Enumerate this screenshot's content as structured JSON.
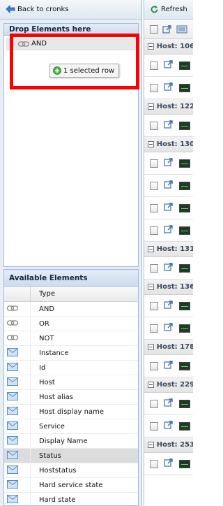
{
  "left_toolbar": {
    "back_label": "Back to cronks"
  },
  "drop_panel": {
    "title": "Drop Elements here",
    "tree_node_label": "AND",
    "drag_tooltip": "1 selected row"
  },
  "available_panel": {
    "title": "Available Elements",
    "column_type": "Type",
    "items": [
      {
        "label": "AND",
        "icon": "link-icon"
      },
      {
        "label": "OR",
        "icon": "link-icon"
      },
      {
        "label": "NOT",
        "icon": "link-icon"
      },
      {
        "label": "Instance",
        "icon": "envelope-icon"
      },
      {
        "label": "Id",
        "icon": "envelope-icon"
      },
      {
        "label": "Host",
        "icon": "envelope-icon"
      },
      {
        "label": "Host alias",
        "icon": "envelope-icon"
      },
      {
        "label": "Host display name",
        "icon": "envelope-icon"
      },
      {
        "label": "Service",
        "icon": "envelope-icon"
      },
      {
        "label": "Display Name",
        "icon": "envelope-icon"
      },
      {
        "label": "Status",
        "icon": "envelope-icon",
        "selected": true
      },
      {
        "label": "Hoststatus",
        "icon": "envelope-icon"
      },
      {
        "label": "Hard service state",
        "icon": "envelope-icon"
      },
      {
        "label": "Hard state",
        "icon": "envelope-icon"
      }
    ]
  },
  "right_toolbar": {
    "refresh_label": "Refresh"
  },
  "host_groups": [
    {
      "label": "Host: 106",
      "rows": 2
    },
    {
      "label": "Host: 122",
      "rows": 1
    },
    {
      "label": "Host: 130",
      "rows": 4
    },
    {
      "label": "Host: 131",
      "rows": 1
    },
    {
      "label": "Host: 136",
      "rows": 2
    },
    {
      "label": "Host: 178",
      "rows": 1
    },
    {
      "label": "Host: 229",
      "rows": 2
    },
    {
      "label": "Host: 253",
      "rows": 1
    }
  ]
}
